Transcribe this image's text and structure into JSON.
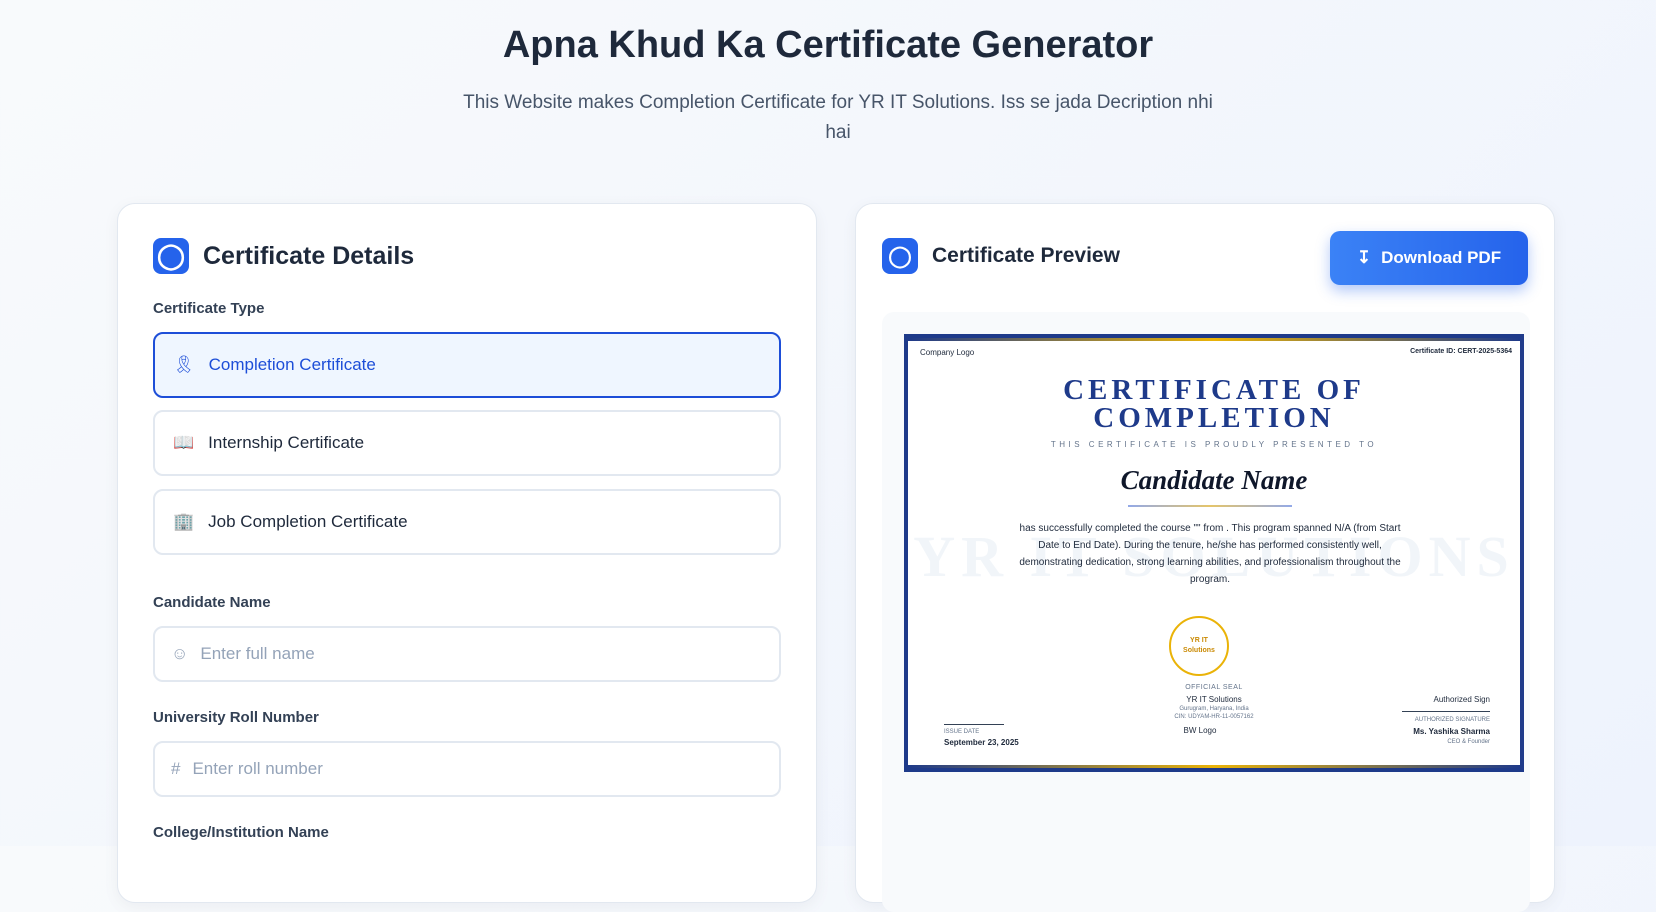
{
  "header": {
    "title": "Apna Khud Ka Certificate Generator",
    "subtitle": "This Website makes Completion Certificate for YR IT Solutions. Iss se jada Decription nhi hai"
  },
  "form": {
    "title": "Certificate Details",
    "type_label": "Certificate Type",
    "types": [
      {
        "label": "Completion Certificate",
        "selected": true
      },
      {
        "label": "Internship Certificate"
      },
      {
        "label": "Job Completion Certificate"
      }
    ],
    "candidate_label": "Candidate Name",
    "candidate_placeholder": "Enter full name",
    "roll_label": "University Roll Number",
    "roll_placeholder": "Enter roll number",
    "college_label": "College/Institution Name"
  },
  "preview": {
    "title": "Certificate Preview",
    "download": "Download PDF"
  },
  "certificate": {
    "logo_alt": "Company Logo",
    "cert_id": "Certificate ID: CERT-2025-5364",
    "title": "CERTIFICATE OF COMPLETION",
    "presented": "THIS CERTIFICATE IS PROUDLY PRESENTED TO",
    "name": "Candidate Name",
    "watermark": "YR IT SOLUTIONS",
    "body": "has successfully completed the course \"\" from . This program spanned N/A (from Start Date to End Date). During the tenure, he/she has performed consistently well, demonstrating dedication, strong learning abilities, and professionalism throughout the program.",
    "seal": "YR IT Solutions",
    "seal_label": "OFFICIAL SEAL",
    "company": "YR IT Solutions",
    "location": "Gurugram, Haryana, India",
    "cin": "CIN: UDYAM-HR-11-0057162",
    "issue_label": "ISSUE DATE",
    "issue_date": "September 23, 2025",
    "bw_logo": "BW Logo",
    "sign_alt": "Authorized Sign",
    "sign_label": "AUTHORIZED SIGNATURE",
    "signer": "Ms. Yashika Sharma",
    "signer_role": "CEO & Founder"
  },
  "colors": {
    "accent": "#2563eb",
    "navy": "#1e3a8a",
    "gold": "#eab308"
  }
}
